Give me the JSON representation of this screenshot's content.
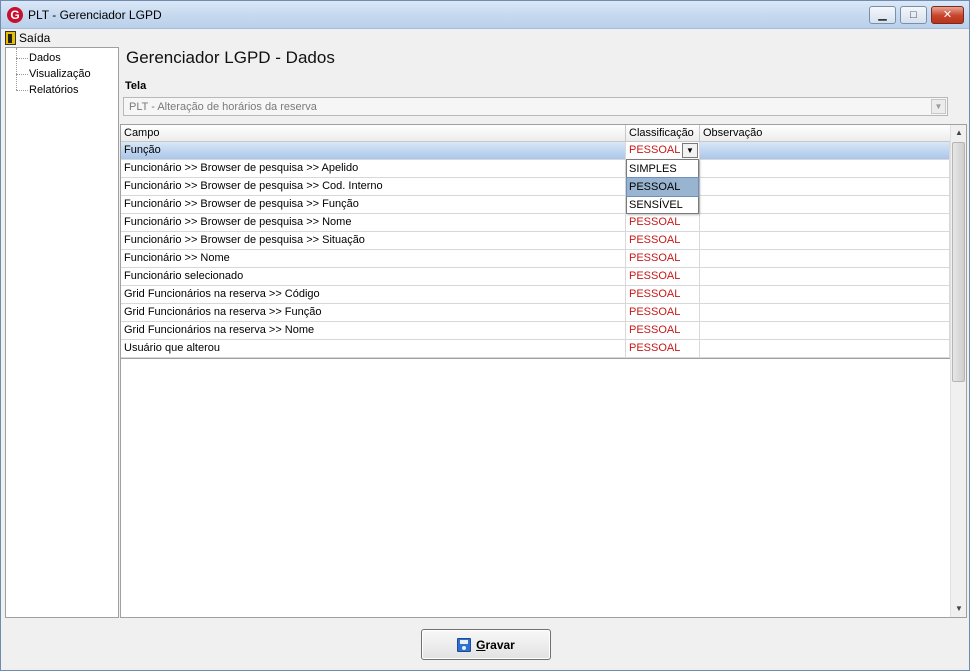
{
  "window": {
    "title": "PLT - Gerenciador LGPD",
    "app_icon": "G",
    "min_glyph": "▁",
    "max_glyph": "□",
    "close_glyph": "✕"
  },
  "menu": {
    "exit_label": "Saída"
  },
  "tree": {
    "items": [
      "Dados",
      "Visualização",
      "Relatórios"
    ]
  },
  "page_title": "Gerenciador LGPD - Dados",
  "tela": {
    "label": "Tela",
    "value": "PLT - Alteração de horários da reserva",
    "arrow": "▼"
  },
  "grid": {
    "columns": [
      "Campo",
      "Classificação",
      "Observação"
    ],
    "rows": [
      {
        "campo": "Função",
        "classificacao": "PESSOAL",
        "observacao": ""
      },
      {
        "campo": "Funcionário >> Browser de pesquisa >> Apelido",
        "classificacao": "",
        "observacao": ""
      },
      {
        "campo": "Funcionário >> Browser de pesquisa >> Cod. Interno",
        "classificacao": "",
        "observacao": ""
      },
      {
        "campo": "Funcionário >> Browser de pesquisa >> Função",
        "classificacao": "",
        "observacao": ""
      },
      {
        "campo": "Funcionário >> Browser de pesquisa >> Nome",
        "classificacao": "PESSOAL",
        "observacao": ""
      },
      {
        "campo": "Funcionário >> Browser de pesquisa >> Situação",
        "classificacao": "PESSOAL",
        "observacao": ""
      },
      {
        "campo": "Funcionário >> Nome",
        "classificacao": "PESSOAL",
        "observacao": ""
      },
      {
        "campo": "Funcionário selecionado",
        "classificacao": "PESSOAL",
        "observacao": ""
      },
      {
        "campo": "Grid Funcionários na reserva >> Código",
        "classificacao": "PESSOAL",
        "observacao": ""
      },
      {
        "campo": "Grid Funcionários na reserva >> Função",
        "classificacao": "PESSOAL",
        "observacao": ""
      },
      {
        "campo": "Grid Funcionários na reserva >> Nome",
        "classificacao": "PESSOAL",
        "observacao": ""
      },
      {
        "campo": "Usuário que alterou",
        "classificacao": "PESSOAL",
        "observacao": ""
      }
    ],
    "dropdown_arrow": "▼",
    "dropdown_options": [
      "SIMPLES",
      "PESSOAL",
      "SENSÍVEL"
    ],
    "dropdown_highlighted": "PESSOAL",
    "scroll_up": "▲",
    "scroll_down": "▼"
  },
  "save_button": {
    "label_first": "G",
    "label_rest": "ravar",
    "icon": "save-icon"
  },
  "colors": {
    "classification_text": "#c81818",
    "selected_row": "#a9c6ea",
    "dropdown_highlight": "#99b4d1"
  }
}
